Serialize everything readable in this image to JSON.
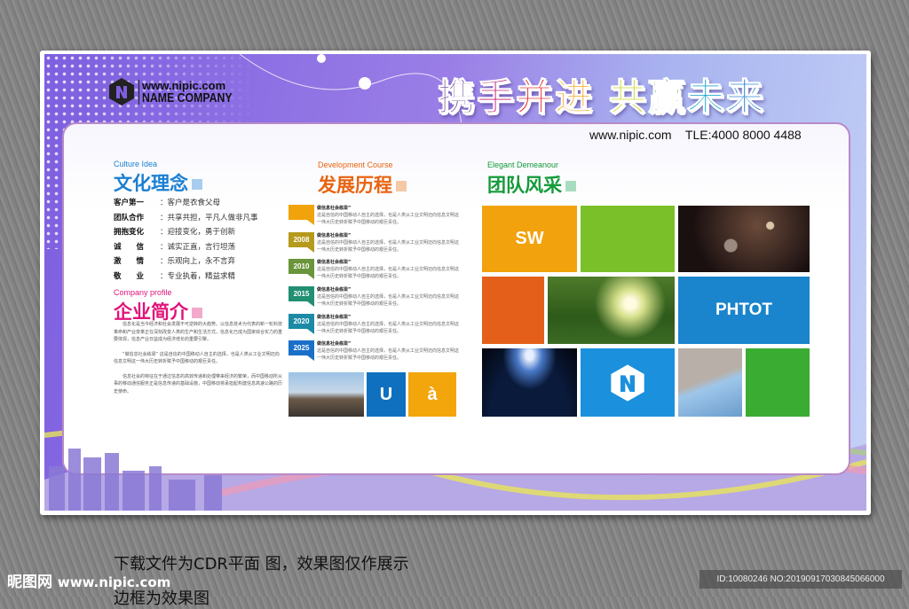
{
  "header": {
    "logo_url": "www.nipic.com",
    "logo_name": "NAME COMPANY",
    "slogan": [
      "携",
      "手",
      "并",
      "进",
      " ",
      "共",
      "赢",
      "未",
      "来"
    ],
    "slogan_colors": [
      "#5b2a86",
      "#c0176e",
      "#e52b2b",
      "#f3a10f",
      "#fff",
      "#c7d51b",
      "#58b94a",
      "#20a6c9",
      "#1d7fd1"
    ],
    "contact_url": "www.nipic.com",
    "contact_tel": "TLE:4000 8000 4488"
  },
  "culture": {
    "en": "Culture Idea",
    "cn": "文化理念",
    "color": "#1a7fd2",
    "items": [
      {
        "k": "客户第一",
        "v": "：客户是衣食父母"
      },
      {
        "k": "团队合作",
        "v": "：共享共担，平凡人做非凡事"
      },
      {
        "k": "拥抱变化",
        "v": "：迎接变化，勇于创新"
      },
      {
        "k": "诚　　信",
        "v": "：诚实正直，言行坦荡"
      },
      {
        "k": "激　　情",
        "v": "：乐观向上，永不言弃"
      },
      {
        "k": "敬　　业",
        "v": "：专业执着，精益求精"
      }
    ]
  },
  "profile": {
    "en": "Company profile",
    "cn": "企业简介",
    "color": "#e0147a",
    "paragraphs": [
      "信息化是当今经济和社会发展不可逆转的大趋势。以信息技术为代表的新一轮科技革命和产业变革正在深刻改变人类的生产和生活方式，信息化已成为国家综合实力的重要体现，信息产业日益成为经济增长的重要引擎。",
      "“做信息社会栋梁” 这是自信的中国移动人自主的选择，也是人类从工业文明迈向信息文明这一伟大历史转折赋予中国移动的艰巨责任。",
      "信息社会的特征在于通过信息的高效传递和处理带来经济的繁荣，而中国移动所从事的移动通信服务正是信息传递的基础设施，中国移动将承担起构建信息高速公路的历史使命。"
    ]
  },
  "development": {
    "en": "Development Course",
    "cn": "发展历程",
    "color": "#e8630f",
    "entries": [
      {
        "year": "",
        "color": "#f0a30a",
        "title": "做信息社会栋梁”",
        "text": "这是自信的中国移动人自主的选择，也是人类从工业文明迈向信息文明这一伟大历史转折赋予中国移动的艰巨责任。"
      },
      {
        "year": "2008",
        "color": "#b59a1c",
        "title": "做信息社会栋梁”",
        "text": "这是自信的中国移动人自主的选择，也是人类从工业文明迈向信息文明这一伟大历史转折赋予中国移动的艰巨责任。"
      },
      {
        "year": "2010",
        "color": "#6a953a",
        "title": "做信息社会栋梁”",
        "text": "这是自信的中国移动人自主的选择，也是人类从工业文明迈向信息文明这一伟大历史转折赋予中国移动的艰巨责任。"
      },
      {
        "year": "2015",
        "color": "#218f72",
        "title": "做信息社会栋梁”",
        "text": "这是自信的中国移动人自主的选择，也是人类从工业文明迈向信息文明这一伟大历史转折赋予中国移动的艰巨责任。"
      },
      {
        "year": "2020",
        "color": "#1b8aa6",
        "title": "做信息社会栋梁”",
        "text": "这是自信的中国移动人自主的选择，也是人类从工业文明迈向信息文明这一伟大历史转折赋予中国移动的艰巨责任。"
      },
      {
        "year": "2025",
        "color": "#1a6fc8",
        "title": "做信息社会栋梁”",
        "text": "这是自信的中国移动人自主的选择，也是人类从工业文明迈向信息文明这一伟大历史转折赋予中国移动的艰巨责任。"
      }
    ],
    "tile_u": "U",
    "tile_a": "à"
  },
  "team": {
    "en": "Elegant Demeanour",
    "cn": "团队风采",
    "color": "#149a3a",
    "tile_sw": "SW",
    "tile_phtot": "PHTOT"
  },
  "footer": {
    "notice": "下载文件为CDR平面 图，效果图仅作展示",
    "notice2": "边框为效果图",
    "watermark_cn": "昵图网",
    "watermark_url": "www.nipic.com",
    "id_text": "ID:10080246 NO:20190917030845066000"
  }
}
